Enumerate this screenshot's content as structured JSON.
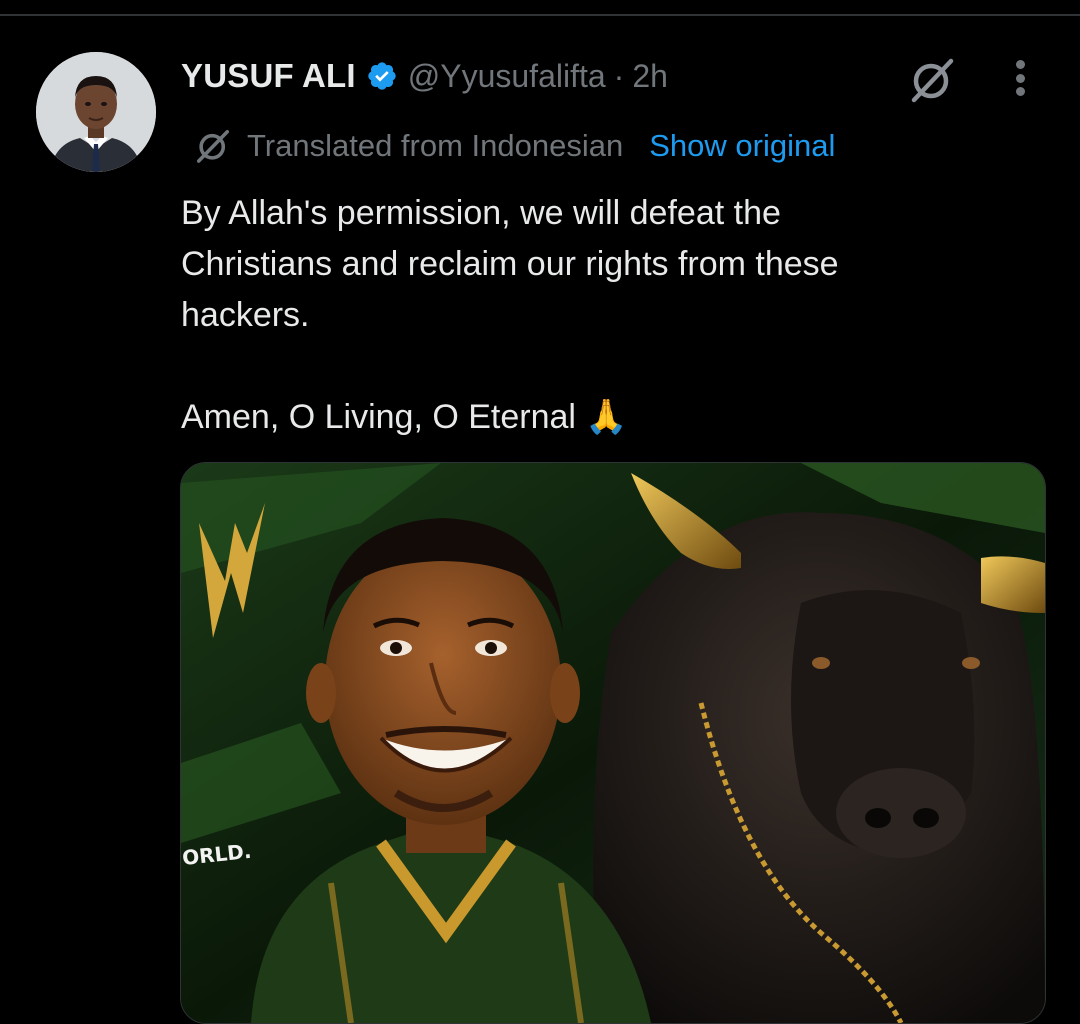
{
  "post": {
    "author": {
      "display_name": "YUSUF ALI",
      "handle": "@Yyusufalifta",
      "verified": true,
      "avatar_icon": "profile-photo"
    },
    "separator": "·",
    "time": "2h",
    "translation": {
      "label": "Translated from Indonesian",
      "action": "Show original",
      "icon": "grok-icon"
    },
    "text": "By Allah's permission, we will defeat the\nChristians and reclaim our rights from these\nhackers.\n\nAmen, O Living, O Eternal 🙏",
    "media": {
      "image_fragment_text": "ORLD."
    }
  },
  "icons": {
    "grok": "grok-icon",
    "more": "more-options-icon",
    "verified": "verified-badge-icon"
  },
  "colors": {
    "background": "#000000",
    "primary_text": "#e7e9ea",
    "secondary_text": "#71767b",
    "link": "#1d9bf0",
    "verified": "#1d9bf0",
    "divider": "#2f3336"
  }
}
